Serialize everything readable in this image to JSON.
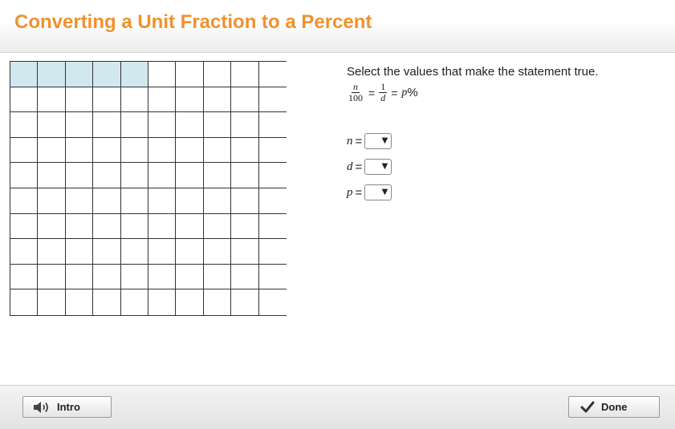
{
  "header": {
    "title": "Converting a Unit Fraction to a Percent"
  },
  "grid": {
    "rows": 10,
    "cols": 10,
    "shaded_count": 5,
    "shade_color": "#d1e8ee"
  },
  "question": {
    "instruction": "Select the values that make the statement true.",
    "equation": {
      "frac1_num": "n",
      "frac1_den": "100",
      "eq": "=",
      "frac2_num": "1",
      "frac2_den": "d",
      "p": "p",
      "pct": "%"
    },
    "fields": [
      {
        "var": "n",
        "eq": "=",
        "value": ""
      },
      {
        "var": "d",
        "eq": "=",
        "value": ""
      },
      {
        "var": "p",
        "eq": "=",
        "value": ""
      }
    ]
  },
  "footer": {
    "intro_label": "Intro",
    "intro_icon": "speaker-icon",
    "done_label": "Done",
    "done_icon": "checkmark-icon"
  },
  "colors": {
    "title": "#f0912e",
    "shaded": "#d1e8ee"
  }
}
